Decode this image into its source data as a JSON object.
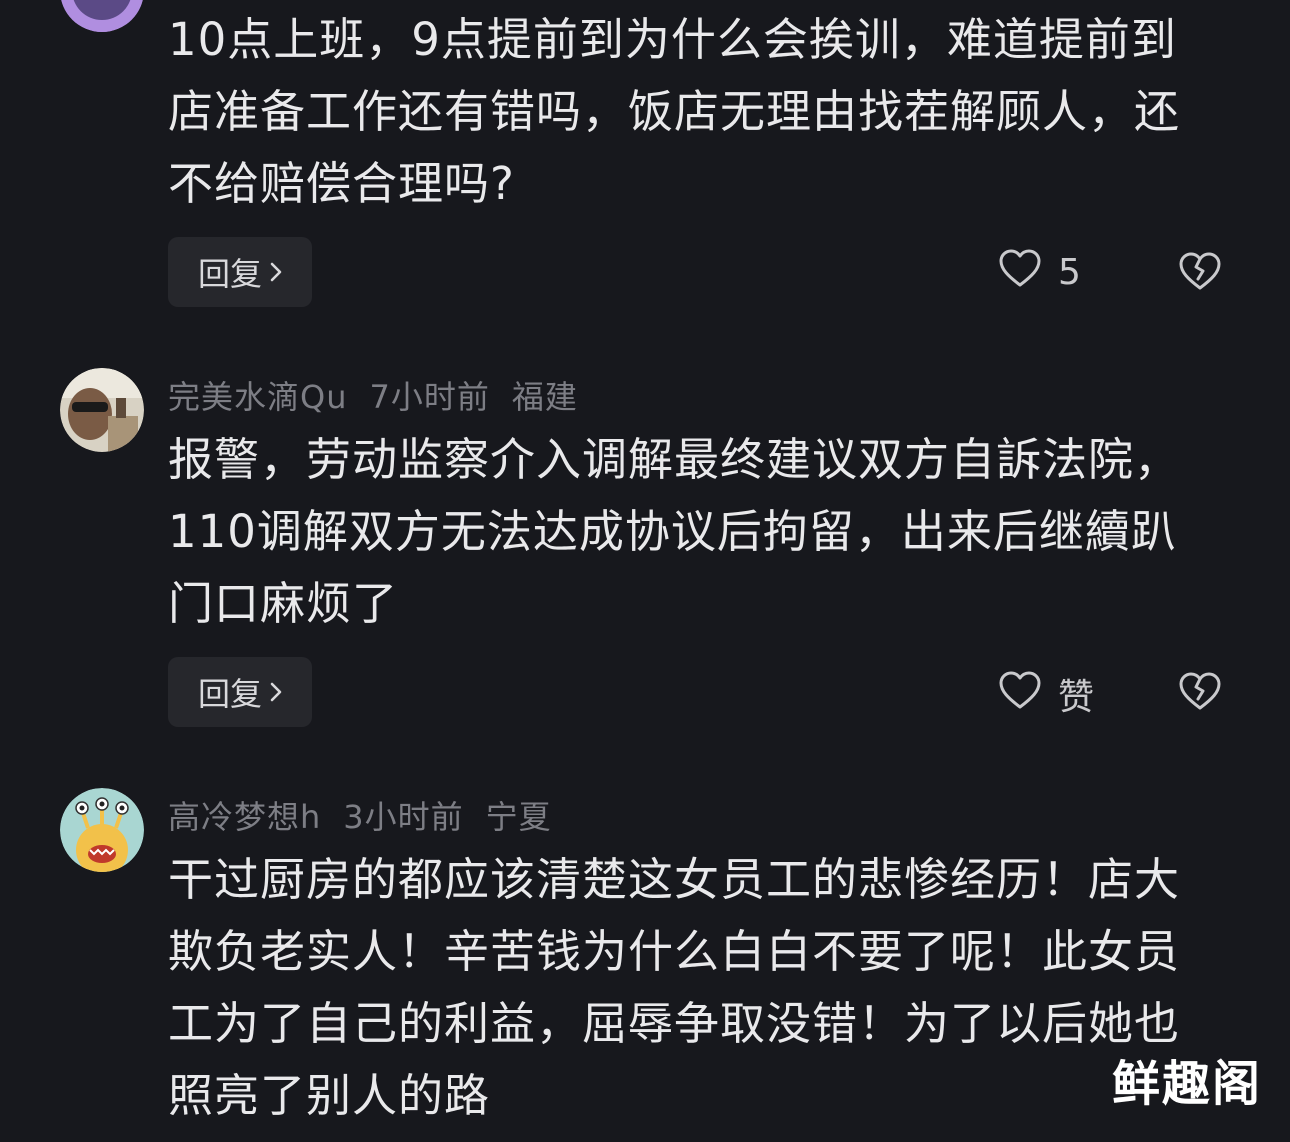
{
  "comments": [
    {
      "text_lines": [
        "10点上班，9点提前到为什么会挨训，难道提前到",
        "店准备工作还有错吗，饭店无理由找茬解顾人，还",
        "不给赔偿合理吗?"
      ],
      "reply_label": "回复",
      "like_label": "5",
      "avatar_color": "#b08ee0"
    },
    {
      "username": "完美水滴Qu",
      "time": "7小时前",
      "location": "福建",
      "text_lines": [
        "报警，劳动监察介入调解最终建议双方自訴法院，",
        "110调解双方无法达成协议后拘留，出来后继續趴",
        "门口麻烦了"
      ],
      "reply_label": "回复",
      "like_label": "赞"
    },
    {
      "username": "高冷梦想h",
      "time": "3小时前",
      "location": "宁夏",
      "text_lines": [
        "干过厨房的都应该清楚这女员工的悲惨经历！店大",
        "欺负老实人！辛苦钱为什么白白不要了呢！此女员",
        "工为了自己的利益，屈辱争取没错！为了以后她也",
        "照亮了别人的路"
      ]
    }
  ],
  "watermark": "鲜趣阁",
  "colors": {
    "background": "#17181d",
    "text": "#e9e9eb",
    "meta": "#7d7e85",
    "button": "#26272c"
  }
}
